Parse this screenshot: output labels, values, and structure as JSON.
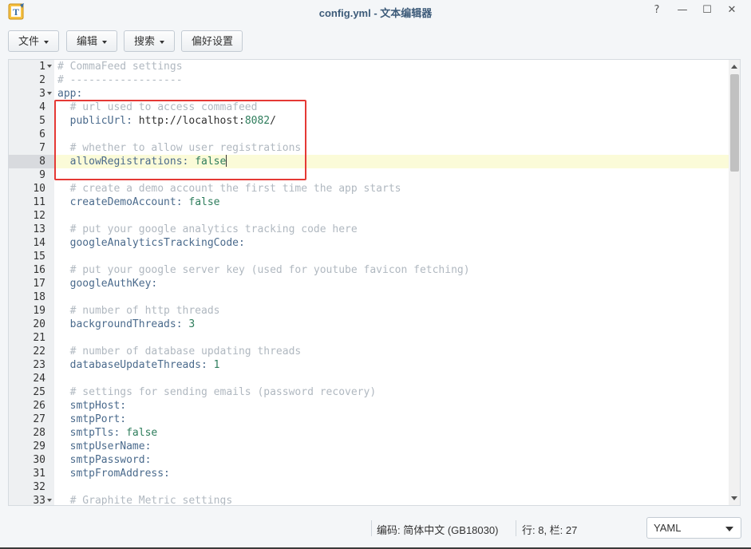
{
  "window": {
    "title": "config.yml - 文本编辑器",
    "help": "?",
    "minimize": "—",
    "maximize": "☐",
    "close": "✕"
  },
  "toolbar": {
    "file": "文件",
    "edit": "编辑",
    "search": "搜索",
    "preferences": "偏好设置"
  },
  "editor": {
    "active_line": 8,
    "lines": [
      {
        "n": "1",
        "fold": true,
        "segs": [
          {
            "t": "# CommaFeed settings",
            "c": "comment"
          }
        ]
      },
      {
        "n": "2",
        "segs": [
          {
            "t": "# ------------------",
            "c": "comment"
          }
        ]
      },
      {
        "n": "3",
        "fold": true,
        "segs": [
          {
            "t": "app:",
            "c": "key"
          }
        ]
      },
      {
        "n": "4",
        "segs": [
          {
            "t": "  # url used to access commafeed",
            "c": "comment"
          }
        ]
      },
      {
        "n": "5",
        "segs": [
          {
            "t": "  publicUrl: ",
            "c": "key"
          },
          {
            "t": "http://localhost:",
            "c": "text"
          },
          {
            "t": "8082",
            "c": "num"
          },
          {
            "t": "/",
            "c": "text"
          }
        ]
      },
      {
        "n": "6",
        "segs": []
      },
      {
        "n": "7",
        "segs": [
          {
            "t": "  # whether to allow user registrations",
            "c": "comment"
          }
        ]
      },
      {
        "n": "8",
        "segs": [
          {
            "t": "  allowRegistrations: ",
            "c": "key"
          },
          {
            "t": "false",
            "c": "bool"
          }
        ]
      },
      {
        "n": "9",
        "segs": []
      },
      {
        "n": "10",
        "segs": [
          {
            "t": "  # create a demo account the first time the app starts",
            "c": "comment"
          }
        ]
      },
      {
        "n": "11",
        "segs": [
          {
            "t": "  createDemoAccount: ",
            "c": "key"
          },
          {
            "t": "false",
            "c": "bool"
          }
        ]
      },
      {
        "n": "12",
        "segs": []
      },
      {
        "n": "13",
        "segs": [
          {
            "t": "  # put your google analytics tracking code here",
            "c": "comment"
          }
        ]
      },
      {
        "n": "14",
        "segs": [
          {
            "t": "  googleAnalyticsTrackingCode:",
            "c": "key"
          }
        ]
      },
      {
        "n": "15",
        "segs": []
      },
      {
        "n": "16",
        "segs": [
          {
            "t": "  # put your google server key (used for youtube favicon fetching)",
            "c": "comment"
          }
        ]
      },
      {
        "n": "17",
        "segs": [
          {
            "t": "  googleAuthKey:",
            "c": "key"
          }
        ]
      },
      {
        "n": "18",
        "segs": []
      },
      {
        "n": "19",
        "segs": [
          {
            "t": "  # number of http threads",
            "c": "comment"
          }
        ]
      },
      {
        "n": "20",
        "segs": [
          {
            "t": "  backgroundThreads: ",
            "c": "key"
          },
          {
            "t": "3",
            "c": "num"
          }
        ]
      },
      {
        "n": "21",
        "segs": []
      },
      {
        "n": "22",
        "segs": [
          {
            "t": "  # number of database updating threads",
            "c": "comment"
          }
        ]
      },
      {
        "n": "23",
        "segs": [
          {
            "t": "  databaseUpdateThreads: ",
            "c": "key"
          },
          {
            "t": "1",
            "c": "num"
          }
        ]
      },
      {
        "n": "24",
        "segs": []
      },
      {
        "n": "25",
        "segs": [
          {
            "t": "  # settings for sending emails (password recovery)",
            "c": "comment"
          }
        ]
      },
      {
        "n": "26",
        "segs": [
          {
            "t": "  smtpHost:",
            "c": "key"
          }
        ]
      },
      {
        "n": "27",
        "segs": [
          {
            "t": "  smtpPort:",
            "c": "key"
          }
        ]
      },
      {
        "n": "28",
        "segs": [
          {
            "t": "  smtpTls: ",
            "c": "key"
          },
          {
            "t": "false",
            "c": "bool"
          }
        ]
      },
      {
        "n": "29",
        "segs": [
          {
            "t": "  smtpUserName:",
            "c": "key"
          }
        ]
      },
      {
        "n": "30",
        "segs": [
          {
            "t": "  smtpPassword:",
            "c": "key"
          }
        ]
      },
      {
        "n": "31",
        "segs": [
          {
            "t": "  smtpFromAddress:",
            "c": "key"
          }
        ]
      },
      {
        "n": "32",
        "segs": []
      },
      {
        "n": "33",
        "fold": true,
        "segs": [
          {
            "t": "  # Graphite Metric settings",
            "c": "comment"
          }
        ]
      }
    ]
  },
  "status": {
    "encoding": "编码: 简体中文 (GB18030)",
    "position": "行: 8, 栏: 27",
    "language": "YAML"
  },
  "colors": {
    "highlight_box": "#e53935",
    "active_line": "#fbfbd8",
    "comment": "#b0b8c0",
    "key": "#4a6a8c"
  }
}
